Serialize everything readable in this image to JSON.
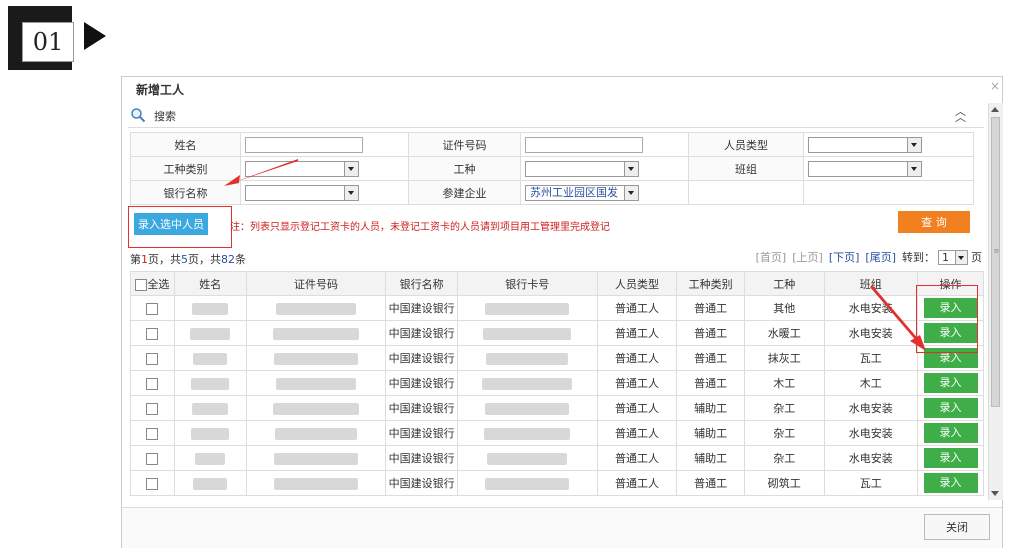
{
  "step": {
    "number": "01"
  },
  "dialog": {
    "title": "新增工人",
    "close_x": "×",
    "search_label": "搜索",
    "collapse_icon": "chevron-up-double",
    "form": {
      "name_label": "姓名",
      "id_label": "证件号码",
      "person_type_label": "人员类型",
      "work_category_label": "工种类别",
      "work_type_label": "工种",
      "team_label": "班组",
      "bank_label": "银行名称",
      "company_label": "参建企业",
      "company_value": "苏州工业园区国发"
    },
    "entry_button": "录入选中人员",
    "notice": "注：列表只显示登记工资卡的人员，未登记工资卡的人员请到项目用工管理里完成登记",
    "query_button": "查 询",
    "page_info": {
      "prefix": "第",
      "current": "1",
      "mid1": "页，共",
      "pages": "5",
      "mid2": "页，共",
      "total": "82",
      "suffix": "条"
    },
    "pager": {
      "first": "[首页]",
      "prev": "[上页]",
      "next": "[下页]",
      "last": "[尾页]",
      "goto": "转到：",
      "page_value": "1",
      "page_unit": "页"
    },
    "columns": [
      "全选",
      "姓名",
      "证件号码",
      "银行名称",
      "银行卡号",
      "人员类型",
      "工种类别",
      "工种",
      "班组",
      "操作"
    ],
    "rows": [
      {
        "bank": "中国建设银行",
        "person_type": "普通工人",
        "work_category": "普通工",
        "work_type": "其他",
        "team": "水电安装",
        "action": "录入"
      },
      {
        "bank": "中国建设银行",
        "person_type": "普通工人",
        "work_category": "普通工",
        "work_type": "水暖工",
        "team": "水电安装",
        "action": "录入"
      },
      {
        "bank": "中国建设银行",
        "person_type": "普通工人",
        "work_category": "普通工",
        "work_type": "抹灰工",
        "team": "瓦工",
        "action": "录入"
      },
      {
        "bank": "中国建设银行",
        "person_type": "普通工人",
        "work_category": "普通工",
        "work_type": "木工",
        "team": "木工",
        "action": "录入"
      },
      {
        "bank": "中国建设银行",
        "person_type": "普通工人",
        "work_category": "辅助工",
        "work_type": "杂工",
        "team": "水电安装",
        "action": "录入"
      },
      {
        "bank": "中国建设银行",
        "person_type": "普通工人",
        "work_category": "辅助工",
        "work_type": "杂工",
        "team": "水电安装",
        "action": "录入"
      },
      {
        "bank": "中国建设银行",
        "person_type": "普通工人",
        "work_category": "辅助工",
        "work_type": "杂工",
        "team": "水电安装",
        "action": "录入"
      },
      {
        "bank": "中国建设银行",
        "person_type": "普通工人",
        "work_category": "普通工",
        "work_type": "砌筑工",
        "team": "瓦工",
        "action": "录入"
      }
    ],
    "close_button": "关闭"
  },
  "colors": {
    "entry_btn": "#3ba9e0",
    "query_btn": "#f08020",
    "record_btn": "#3fae49",
    "highlight": "#e03030",
    "notice": "#d02020"
  }
}
